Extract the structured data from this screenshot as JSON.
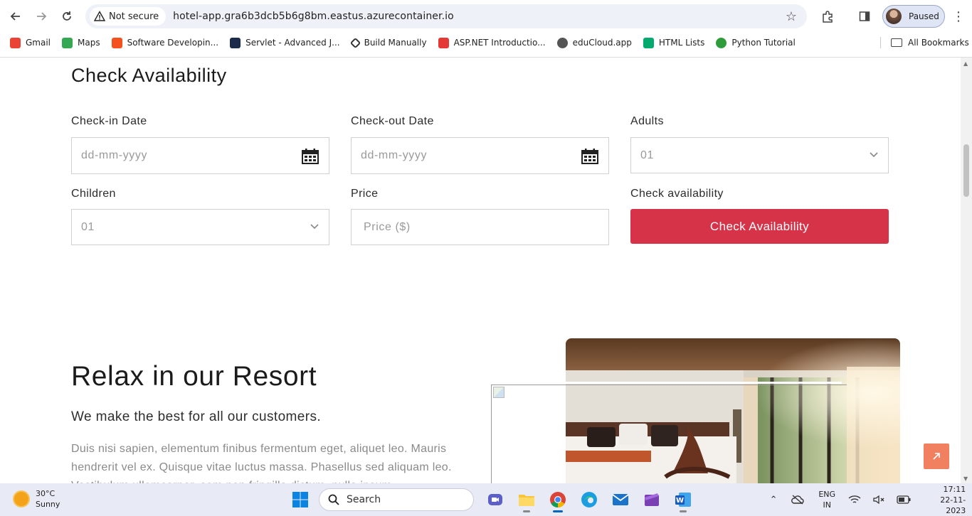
{
  "browser": {
    "security_label": "Not secure",
    "url": "hotel-app.gra6b3dcb5b6g8bm.eastus.azurecontainer.io",
    "profile_status": "Paused"
  },
  "bookmarks": [
    {
      "label": "Gmail",
      "color": "#ea4335"
    },
    {
      "label": "Maps",
      "color": "#34a853"
    },
    {
      "label": "Software Developin...",
      "color": "#f4511e"
    },
    {
      "label": "Servlet - Advanced J...",
      "color": "#1c2b4a"
    },
    {
      "label": "Build Manually",
      "color": "#333333"
    },
    {
      "label": "ASP.NET Introductio...",
      "color": "#e53935"
    },
    {
      "label": "eduCloud.app",
      "color": "#555555"
    },
    {
      "label": "HTML Lists",
      "color": "#04aa6d"
    },
    {
      "label": "Python Tutorial",
      "color": "#2e9c3b"
    }
  ],
  "bookmarks_all": "All Bookmarks",
  "availability": {
    "title": "Check Availability",
    "checkin_label": "Check-in Date",
    "checkin_placeholder": "dd-mm-yyyy",
    "checkout_label": "Check-out Date",
    "checkout_placeholder": "dd-mm-yyyy",
    "adults_label": "Adults",
    "adults_value": "01",
    "children_label": "Children",
    "children_value": "01",
    "price_label": "Price",
    "price_placeholder": "Price ($)",
    "check_label": "Check availability",
    "button_label": "Check Availability",
    "button_color": "#d63348"
  },
  "resort": {
    "title": "Relax in our Resort",
    "subtitle": "We make the best for all our customers.",
    "body": "Duis nisi sapien, elementum finibus fermentum eget, aliquet leo. Mauris hendrerit vel ex. Quisque vitae luctus massa. Phasellus sed aliquam leo. Vestibulum ullamcorper, sem non fringilla dictum, nulla ipsum"
  },
  "taskbar": {
    "temperature": "30°C",
    "weather": "Sunny",
    "search_placeholder": "Search",
    "lang_top": "ENG",
    "lang_bottom": "IN",
    "time": "17:11",
    "date": "22-11-2023"
  }
}
